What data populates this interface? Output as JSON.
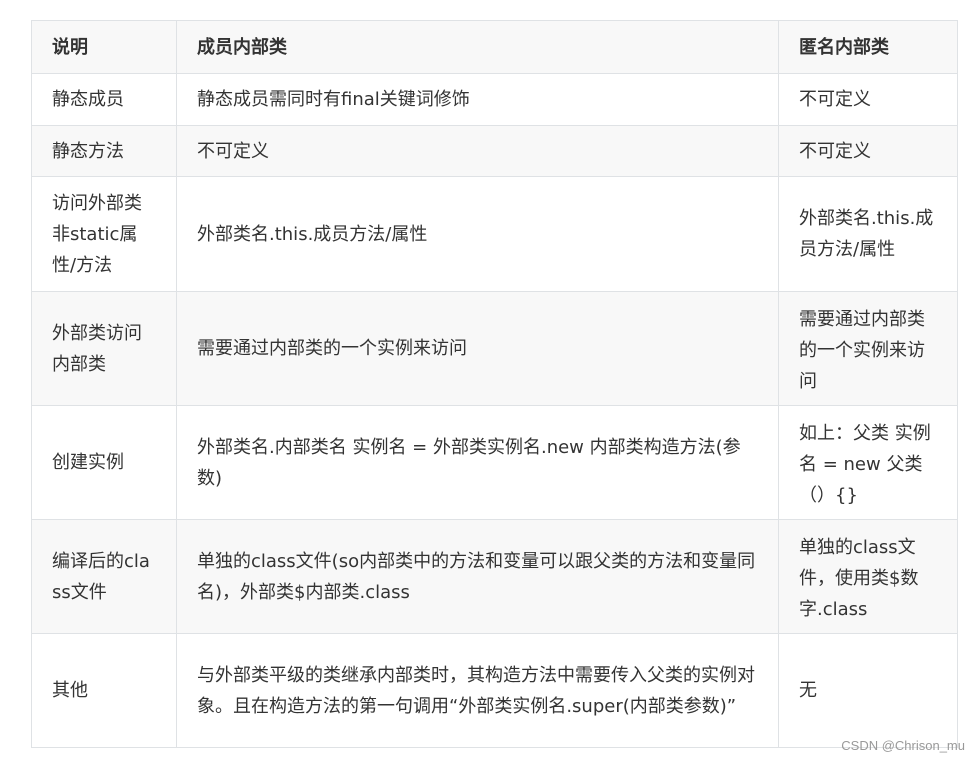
{
  "table": {
    "headers": [
      "说明",
      "成员内部类",
      "匿名内部类"
    ],
    "rows": [
      {
        "label": "静态成员",
        "member": "静态成员需同时有final关键词修饰",
        "anon": "不可定义"
      },
      {
        "label": "静态方法",
        "member": "不可定义",
        "anon": "不可定义"
      },
      {
        "label": "访问外部类非static属性/方法",
        "member": "外部类名.this.成员方法/属性",
        "anon": "外部类名.this.成员方法/属性"
      },
      {
        "label": "外部类访问内部类",
        "member": "需要通过内部类的一个实例来访问",
        "anon": "需要通过内部类的一个实例来访问"
      },
      {
        "label": "创建实例",
        "member": "外部类名.内部类名 实例名 = 外部类实例名.new 内部类构造方法(参数)",
        "anon": "如上：父类 实例名 = new 父类（）{}"
      },
      {
        "label": "编译后的class文件",
        "member": "单独的class文件(so内部类中的方法和变量可以跟父类的方法和变量同名)，外部类$内部类.class",
        "anon": "单独的class文件，使用类$数字.class"
      },
      {
        "label": "其他",
        "member": "与外部类平级的类继承内部类时，其构造方法中需要传入父类的实例对象。且在构造方法的第一句调用“外部类实例名.super(内部类参数)”",
        "anon": "无"
      }
    ]
  },
  "watermark": "CSDN @Chrison_mu"
}
